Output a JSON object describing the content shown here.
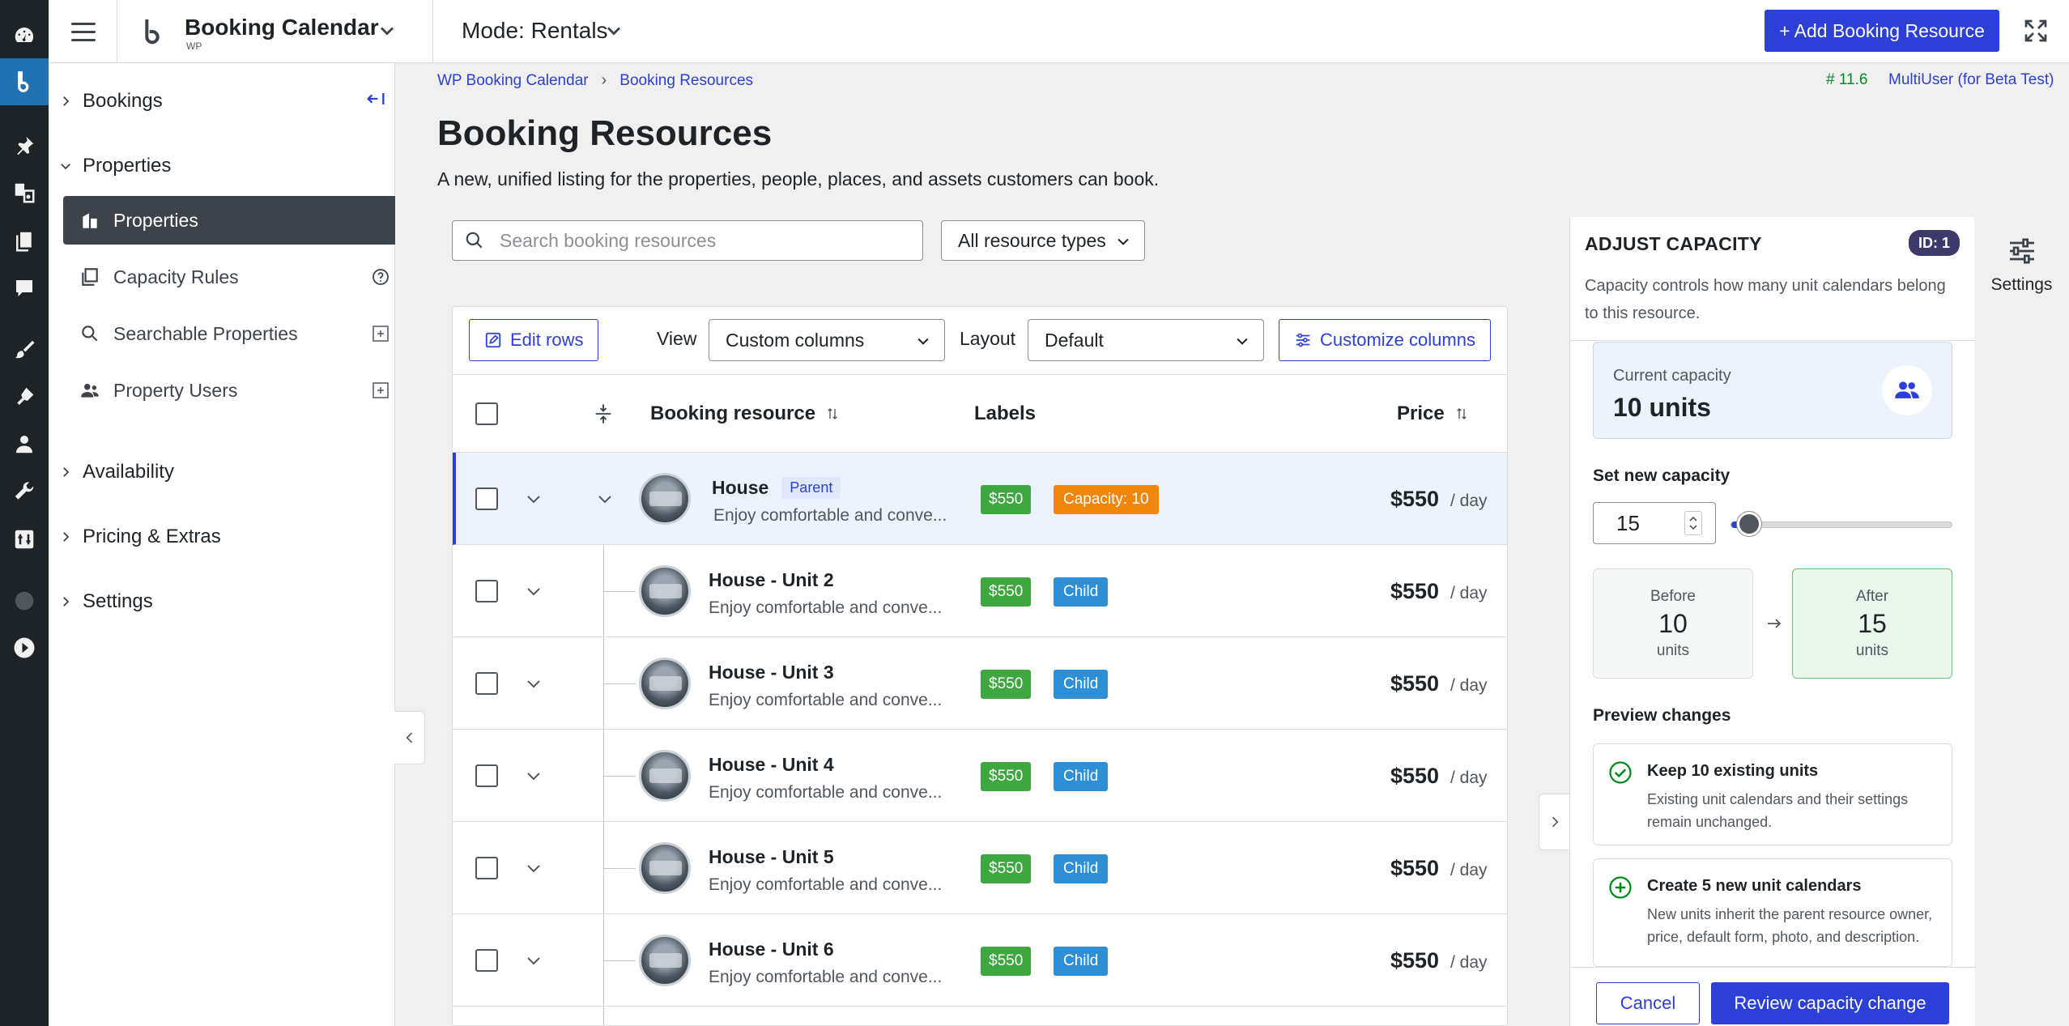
{
  "header": {
    "brand_title": "Booking Calendar",
    "brand_sub": "WP",
    "mode_label": "Mode: Rentals",
    "add_button": "+ Add Booking Resource"
  },
  "nav": {
    "bookings": "Bookings",
    "properties_section": "Properties",
    "items": [
      {
        "label": "Properties"
      },
      {
        "label": "Capacity Rules"
      },
      {
        "label": "Searchable Properties"
      },
      {
        "label": "Property Users"
      }
    ],
    "availability": "Availability",
    "pricing": "Pricing & Extras",
    "settings": "Settings"
  },
  "breadcrumb": {
    "root": "WP Booking Calendar",
    "sep": "›",
    "current": "Booking Resources"
  },
  "version": "# 11.6",
  "multiuser": "MultiUser (for Beta Test)",
  "page": {
    "title": "Booking Resources",
    "description": "A new, unified listing for the properties, people, places, and assets customers can book."
  },
  "filters": {
    "search_placeholder": "Search booking resources",
    "type_select": "All resource types"
  },
  "toolbar": {
    "edit_rows": "Edit rows",
    "view_label": "View",
    "view_value": "Custom columns",
    "layout_label": "Layout",
    "layout_value": "Default",
    "customize": "Customize columns"
  },
  "table": {
    "columns": [
      "Booking resource",
      "Labels",
      "Price"
    ],
    "rows": [
      {
        "name": "House",
        "tag": "Parent",
        "desc": "Enjoy comfortable and conve...",
        "price_badge": "$550",
        "label2": "Capacity: 10",
        "price": "$550",
        "per": "/ day"
      },
      {
        "name": "House - Unit 2",
        "desc": "Enjoy comfortable and conve...",
        "price_badge": "$550",
        "label2": "Child",
        "price": "$550",
        "per": "/ day"
      },
      {
        "name": "House - Unit 3",
        "desc": "Enjoy comfortable and conve...",
        "price_badge": "$550",
        "label2": "Child",
        "price": "$550",
        "per": "/ day"
      },
      {
        "name": "House - Unit 4",
        "desc": "Enjoy comfortable and conve...",
        "price_badge": "$550",
        "label2": "Child",
        "price": "$550",
        "per": "/ day"
      },
      {
        "name": "House - Unit 5",
        "desc": "Enjoy comfortable and conve...",
        "price_badge": "$550",
        "label2": "Child",
        "price": "$550",
        "per": "/ day"
      },
      {
        "name": "House - Unit 6",
        "desc": "Enjoy comfortable and conve...",
        "price_badge": "$550",
        "label2": "Child",
        "price": "$550",
        "per": "/ day"
      }
    ]
  },
  "panel": {
    "title": "ADJUST CAPACITY",
    "id_badge": "ID: 1",
    "description": "Capacity controls how many unit calendars belong to this resource.",
    "current_label": "Current capacity",
    "current_value": "10 units",
    "set_label": "Set new capacity",
    "new_value": "15",
    "slider_fraction": 0.05,
    "before_label": "Before",
    "before_value": "10",
    "after_label": "After",
    "after_value": "15",
    "units": "units",
    "preview_label": "Preview changes",
    "keep_title": "Keep 10 existing units",
    "keep_sub": "Existing unit calendars and their settings remain unchanged.",
    "create_title": "Create 5 new unit calendars",
    "create_sub": "New units inherit the parent resource owner, price, default form, photo, and description.",
    "cancel": "Cancel",
    "review": "Review capacity change"
  },
  "settings_tab": "Settings",
  "colors": {
    "accent": "#2c3fd6",
    "price_badge": "#3ea740",
    "child_badge": "#2e8fd6",
    "capacity_badge": "#f0860a",
    "admin_bar": "#1d2327"
  }
}
